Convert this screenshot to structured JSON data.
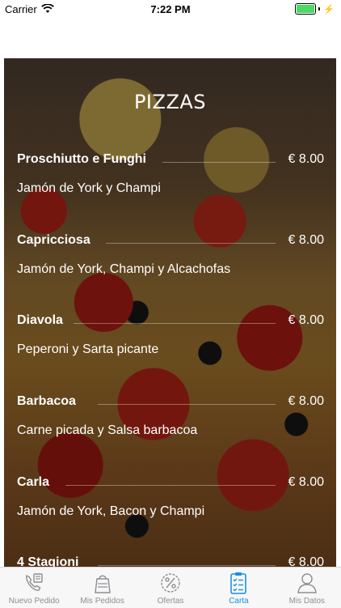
{
  "status_bar": {
    "carrier": "Carrier",
    "time": "7:22 PM",
    "battery_level": 1.0
  },
  "menu": {
    "title": "PIZZAS",
    "items": [
      {
        "name": "Proschiutto e Funghi",
        "price": "€ 8.00",
        "description": "Jamón de York y Champi"
      },
      {
        "name": "Capricciosa",
        "price": "€ 8.00",
        "description": "Jamón de York, Champi y Alcachofas"
      },
      {
        "name": "Diavola",
        "price": "€ 8.00",
        "description": "Peperoni y Sarta picante"
      },
      {
        "name": "Barbacoa",
        "price": "€ 8.00",
        "description": "Carne picada y Salsa barbacoa"
      },
      {
        "name": "Carla",
        "price": "€ 8.00",
        "description": "Jamón de York, Bacon y Champi"
      },
      {
        "name": "4 Stagioni",
        "price": "€ 8.00",
        "description": ""
      }
    ]
  },
  "tab_bar": {
    "active_color": "#1a8fe3",
    "inactive_color": "#8e8e93",
    "tabs": [
      {
        "label": "Nuevo Pedido",
        "icon": "phone-order-icon"
      },
      {
        "label": "Mis Pedidos",
        "icon": "delivery-bag-icon"
      },
      {
        "label": "Ofertas",
        "icon": "percent-badge-icon"
      },
      {
        "label": "Carta",
        "icon": "clipboard-list-icon",
        "active": true
      },
      {
        "label": "Mis Datos",
        "icon": "user-profile-icon"
      }
    ]
  }
}
